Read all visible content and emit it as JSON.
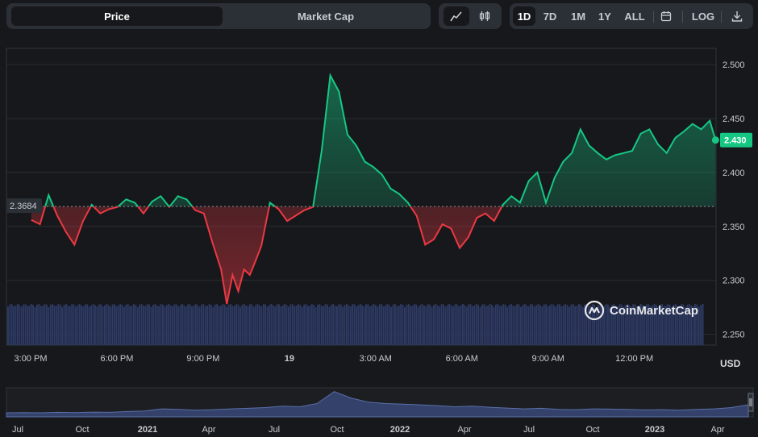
{
  "toolbar": {
    "tabs": [
      {
        "label": "Price"
      },
      {
        "label": "Market Cap"
      }
    ],
    "timeframes": [
      {
        "label": "1D"
      },
      {
        "label": "7D"
      },
      {
        "label": "1M"
      },
      {
        "label": "1Y"
      },
      {
        "label": "ALL"
      }
    ],
    "log_label": "LOG",
    "icons": {
      "line": "line-chart-icon",
      "candle": "candlestick-icon",
      "calendar": "calendar-icon",
      "download": "download-icon"
    }
  },
  "currency": "USD",
  "watermark": "CoinMarketCap",
  "colors": {
    "up": "#16c784",
    "down": "#ea3943",
    "volume": "#3a4a78",
    "nav": "#5a6fa8"
  },
  "chart_data": {
    "type": "line",
    "ylim": [
      2.24,
      2.515
    ],
    "yticks": [
      "2.500",
      "2.450",
      "2.400",
      "2.350",
      "2.300",
      "2.250"
    ],
    "ytick_values": [
      2.5,
      2.45,
      2.4,
      2.35,
      2.3,
      2.25
    ],
    "xticks": [
      "3:00 PM",
      "6:00 PM",
      "9:00 PM",
      "19",
      "3:00 AM",
      "6:00 AM",
      "9:00 AM",
      "12:00 PM"
    ],
    "xtick_hours": [
      0,
      3,
      6,
      9,
      12,
      15,
      18,
      21
    ],
    "baseline_label": "2.3684",
    "baseline": 2.3684,
    "current_label": "2.430",
    "current": 2.43,
    "x_hours": [
      -0.2,
      0.1,
      0.4,
      0.7,
      1.0,
      1.3,
      1.6,
      1.9,
      2.2,
      2.5,
      2.8,
      3.1,
      3.4,
      3.7,
      4.0,
      4.3,
      4.6,
      4.9,
      5.2,
      5.5,
      5.8,
      6.1,
      6.4,
      6.6,
      6.8,
      7.0,
      7.2,
      7.4,
      7.6,
      7.8,
      8.1,
      8.4,
      8.7,
      9.0,
      9.3,
      9.6,
      9.9,
      10.2,
      10.5,
      10.8,
      11.1,
      11.4,
      11.7,
      12.0,
      12.3,
      12.6,
      12.9,
      13.2,
      13.5,
      13.8,
      14.1,
      14.4,
      14.7,
      15.0,
      15.3,
      15.6,
      15.9,
      16.2,
      16.5,
      16.8,
      17.1,
      17.4,
      17.7,
      18.0,
      18.3,
      18.6,
      18.9,
      19.2,
      19.5,
      19.8,
      20.1,
      20.4,
      20.7,
      21.0,
      21.3,
      21.6,
      21.9,
      22.2,
      22.5,
      22.8,
      23.1,
      23.4,
      23.6
    ],
    "price": [
      2.356,
      2.352,
      2.379,
      2.36,
      2.345,
      2.333,
      2.355,
      2.37,
      2.362,
      2.366,
      2.368,
      2.375,
      2.372,
      2.362,
      2.373,
      2.378,
      2.368,
      2.378,
      2.375,
      2.365,
      2.362,
      2.335,
      2.31,
      2.278,
      2.305,
      2.29,
      2.31,
      2.305,
      2.318,
      2.332,
      2.372,
      2.366,
      2.355,
      2.36,
      2.365,
      2.368,
      2.42,
      2.49,
      2.475,
      2.435,
      2.425,
      2.41,
      2.405,
      2.398,
      2.385,
      2.38,
      2.372,
      2.36,
      2.333,
      2.338,
      2.352,
      2.348,
      2.33,
      2.34,
      2.358,
      2.362,
      2.355,
      2.37,
      2.378,
      2.372,
      2.392,
      2.4,
      2.372,
      2.395,
      2.41,
      2.418,
      2.44,
      2.425,
      2.418,
      2.412,
      2.416,
      2.418,
      2.42,
      2.436,
      2.44,
      2.426,
      2.418,
      2.432,
      2.438,
      2.445,
      2.44,
      2.448,
      2.43
    ],
    "volume_range": "small"
  },
  "navigator": {
    "labels": [
      "Jul",
      "Oct",
      "2021",
      "Apr",
      "Jul",
      "Oct",
      "2022",
      "Apr",
      "Jul",
      "Oct",
      "2023",
      "Apr"
    ],
    "bold": [
      false,
      false,
      true,
      false,
      false,
      false,
      true,
      false,
      false,
      false,
      true,
      false
    ]
  }
}
